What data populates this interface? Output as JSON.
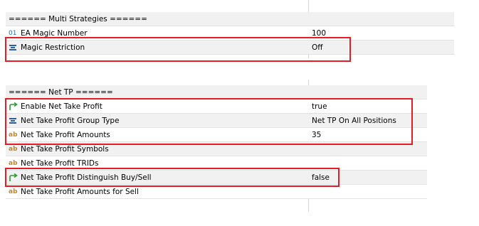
{
  "group1": {
    "header": "====== Multi Strategies ======",
    "rows": [
      {
        "name": "EA Magic Number",
        "value": "100",
        "icon": "integer-icon"
      },
      {
        "name": "Magic Restriction",
        "value": "Off",
        "icon": "enum-list-icon"
      }
    ]
  },
  "group2": {
    "header": "====== Net TP ======",
    "rows": [
      {
        "name": "Enable Net Take Profit",
        "value": "true",
        "icon": "bool-arrow-icon"
      },
      {
        "name": "Net Take Profit Group Type",
        "value": "Net TP On All Positions",
        "icon": "enum-list-icon"
      },
      {
        "name": "Net Take Profit Amounts",
        "value": "35",
        "icon": "string-ab-icon"
      },
      {
        "name": "Net Take Profit Symbols",
        "value": "",
        "icon": "string-ab-icon"
      },
      {
        "name": "Net Take Profit TRIDs",
        "value": "",
        "icon": "string-ab-icon"
      },
      {
        "name": "Net Take Profit Distinguish Buy/Sell",
        "value": "false",
        "icon": "bool-arrow-icon"
      },
      {
        "name": "Net Take Profit Amounts for Sell",
        "value": "",
        "icon": "string-ab-icon"
      }
    ]
  },
  "icon_glyphs": {
    "integer": "01",
    "string": "ab"
  },
  "colors": {
    "highlight_box": "#e21d24",
    "alt_row": "#f1f1f1",
    "bool_icon": "#2e9a2e",
    "enum_icon": "#2a5fa8",
    "string_icon": "#c8861c"
  }
}
